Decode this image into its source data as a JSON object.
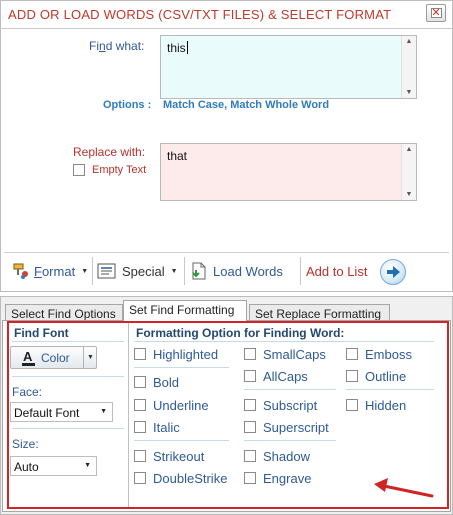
{
  "dialog": {
    "title": "ADD OR LOAD WORDS (CSV/TXT FILES) & SELECT FORMAT",
    "find_label_pre": "Fi",
    "find_label_u": "n",
    "find_label_post": "d what:",
    "find_value": "this",
    "options_label": "Options :",
    "options_value": "Match Case, Match Whole Word",
    "replace_label": "Replace with:",
    "replace_value": "that",
    "empty_text_label": "Empty Text"
  },
  "toolbar": {
    "format_pre": "",
    "format_u": "F",
    "format_post": "ormat",
    "special_label": "Special",
    "load_words_label": "Load Words",
    "add_to_list_label": "Add to List"
  },
  "tabs": [
    {
      "label": "Select Find Options"
    },
    {
      "label": "Set Find Formatting"
    },
    {
      "label": "Set Replace Formatting"
    }
  ],
  "find_font": {
    "title": "Find Font",
    "color_label": "Color",
    "face_label": "Face:",
    "face_value": "Default Font",
    "size_label": "Size:",
    "size_value": "Auto"
  },
  "formatting": {
    "title": "Formatting Option for Finding Word:",
    "options": [
      "Highlighted",
      "Bold",
      "Underline",
      "Italic",
      "Strikeout",
      "DoubleStrike",
      "SmallCaps",
      "AllCaps",
      "Subscript",
      "Superscript",
      "Shadow",
      "Engrave",
      "Emboss",
      "Outline",
      "Hidden"
    ]
  },
  "colors": {
    "title_red": "#c0392b",
    "label_blue": "#2e5a96",
    "find_bg": "#e9fbfb",
    "replace_bg": "#fdeaea",
    "frame_red": "#d12424"
  }
}
